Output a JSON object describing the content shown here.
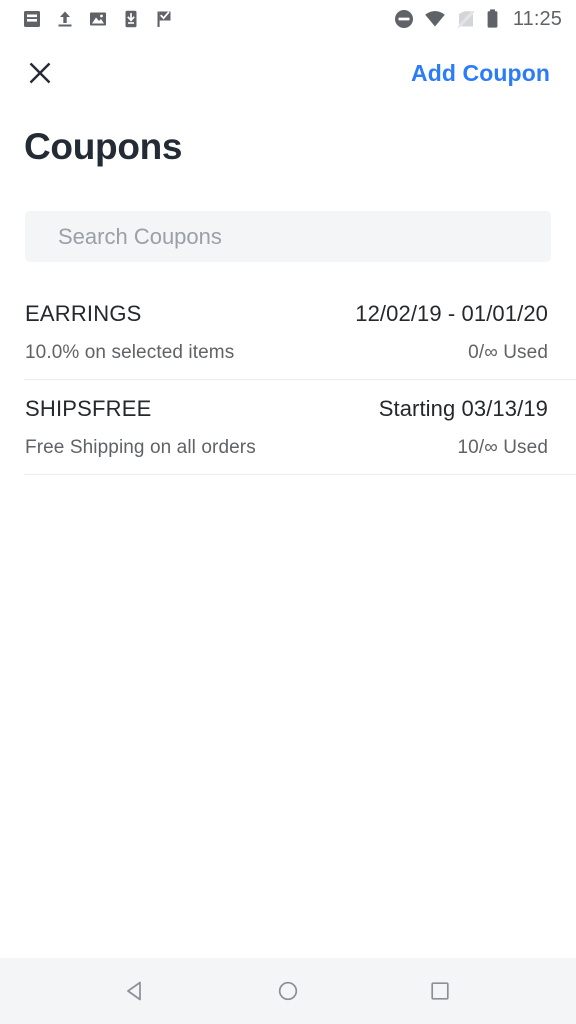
{
  "status_bar": {
    "time": "11:25",
    "notification_icons": [
      {
        "name": "article-icon"
      },
      {
        "name": "upload-icon"
      },
      {
        "name": "image-icon"
      },
      {
        "name": "download-to-phone-icon"
      },
      {
        "name": "checkmark-flag-icon"
      }
    ],
    "system_icons": [
      {
        "name": "do-not-disturb-icon"
      },
      {
        "name": "wifi-icon"
      },
      {
        "name": "no-sim-icon"
      },
      {
        "name": "battery-icon"
      }
    ]
  },
  "app_bar": {
    "close_label": "Close",
    "action_label": "Add Coupon",
    "action_color": "#2b7cf6"
  },
  "page": {
    "title": "Coupons",
    "title_color": "#232b35"
  },
  "search": {
    "placeholder": "Search Coupons",
    "value": "",
    "background": "#f4f5f7"
  },
  "coupons": [
    {
      "code": "EARRINGS",
      "dates": "12/02/19 - 01/01/20",
      "description": "10.0% on selected items",
      "used": "0/∞ Used"
    },
    {
      "code": "SHIPSFREE",
      "dates": "Starting 03/13/19",
      "description": "Free Shipping on all orders",
      "used": "10/∞ Used"
    }
  ],
  "nav_bar": {
    "background": "#f4f5f7",
    "buttons": [
      {
        "name": "back-button"
      },
      {
        "name": "home-button"
      },
      {
        "name": "recents-button"
      }
    ]
  }
}
